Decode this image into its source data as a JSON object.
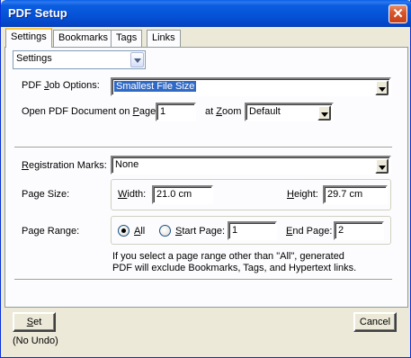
{
  "window": {
    "title": "PDF Setup",
    "close_glyph": "✕"
  },
  "tabs": [
    {
      "label": "Settings",
      "active": true
    },
    {
      "label": "Bookmarks",
      "active": false
    },
    {
      "label": "Tags",
      "active": false
    },
    {
      "label": "Links",
      "active": false
    }
  ],
  "section_select": {
    "value": "Settings"
  },
  "job_options": {
    "label": "PDF Job Options:",
    "value": "Smallest File Size"
  },
  "open_doc": {
    "label": "Open PDF Document on Page",
    "page_value": "1",
    "zoom_label": "at Zoom",
    "zoom_value": "Default"
  },
  "registration": {
    "label": "Registration Marks:",
    "value": "None"
  },
  "page_size": {
    "label": "Page Size:",
    "width_label": "Width:",
    "width_value": "21.0 cm",
    "height_label": "Height:",
    "height_value": "29.7 cm"
  },
  "page_range": {
    "label": "Page Range:",
    "all_label": "All",
    "all_selected": true,
    "start_label": "Start Page:",
    "start_value": "1",
    "end_label": "End Page:",
    "end_value": "2"
  },
  "note": {
    "line1": "If you select a page range other than \"All\",  generated",
    "line2": "PDF will exclude Bookmarks, Tags, and Hypertext links."
  },
  "footer": {
    "set_label": "Set",
    "no_undo": "(No Undo)",
    "cancel_label": "Cancel"
  },
  "colors": {
    "titlebar": "#0552d6",
    "selection": "#316ac5",
    "dialog_bg": "#ece9d8",
    "radio_dot": "#21a121"
  }
}
